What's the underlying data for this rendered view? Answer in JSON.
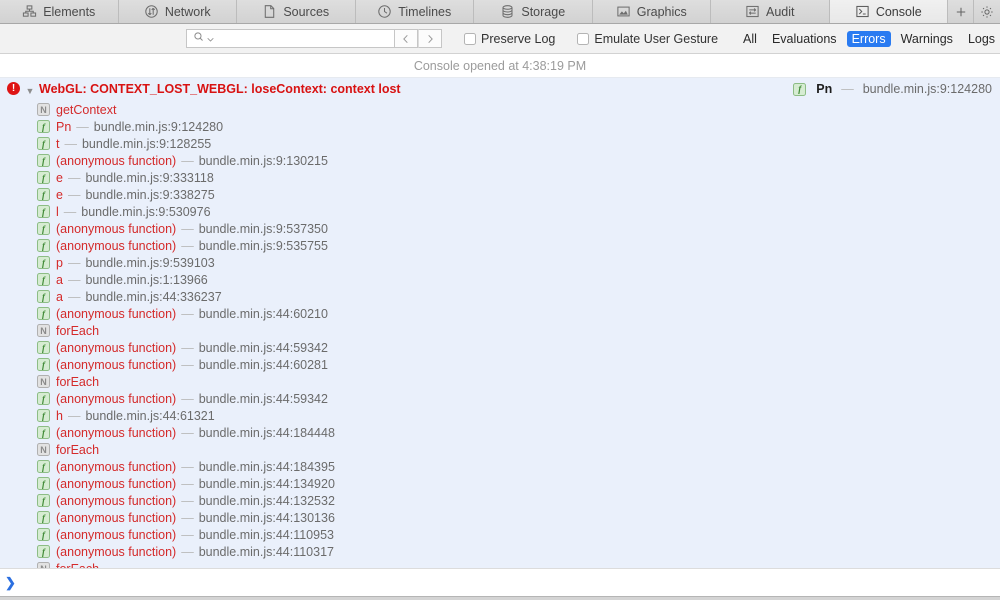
{
  "tabs": [
    {
      "label": "Elements",
      "icon": "elements-icon",
      "active": false
    },
    {
      "label": "Network",
      "icon": "network-icon",
      "active": false
    },
    {
      "label": "Sources",
      "icon": "sources-icon",
      "active": false
    },
    {
      "label": "Timelines",
      "icon": "timelines-icon",
      "active": false
    },
    {
      "label": "Storage",
      "icon": "storage-icon",
      "active": false
    },
    {
      "label": "Graphics",
      "icon": "graphics-icon",
      "active": false
    },
    {
      "label": "Audit",
      "icon": "audit-icon",
      "active": false
    },
    {
      "label": "Console",
      "icon": "console-icon",
      "active": true
    }
  ],
  "tabbar_buttons": [
    {
      "name": "add-tab-button",
      "glyph": "+"
    },
    {
      "name": "settings-gear-button",
      "glyph": "gear-icon"
    }
  ],
  "toolbar": {
    "search_value": "",
    "search_placeholder": "",
    "search_icon": "search-icon",
    "prev_result_label": "‹",
    "next_result_label": "›",
    "checkboxes": [
      {
        "label": "Preserve Log",
        "checked": false
      },
      {
        "label": "Emulate User Gesture",
        "checked": false
      }
    ],
    "filters": [
      {
        "label": "All",
        "active": false
      },
      {
        "label": "Evaluations",
        "active": false
      },
      {
        "label": "Errors",
        "active": true
      },
      {
        "label": "Warnings",
        "active": false
      },
      {
        "label": "Logs",
        "active": false
      }
    ],
    "clear_icon": "refresh-clear-icon",
    "trash_icon": "trash-icon",
    "active_filter_color": "#2a7bf1"
  },
  "console": {
    "opened_at": "Console opened at 4:38:19 PM",
    "prompt_glyph": "❯",
    "error": {
      "badge": "!",
      "disclosure": "▼",
      "message": "WebGL: CONTEXT_LOST_WEBGL: loseContext: context lost",
      "source_badge": "f",
      "source_function": "Pn",
      "source_dash": "—",
      "source_location": "bundle.min.js:9:124280",
      "color": "#d81212"
    },
    "stack_frames": [
      {
        "type": "native",
        "name": "getContext",
        "location": ""
      },
      {
        "type": "function",
        "name": "Pn",
        "location": "bundle.min.js:9:124280"
      },
      {
        "type": "function",
        "name": "t",
        "location": "bundle.min.js:9:128255"
      },
      {
        "type": "function",
        "name": "(anonymous function)",
        "location": "bundle.min.js:9:130215"
      },
      {
        "type": "function",
        "name": "e",
        "location": "bundle.min.js:9:333118"
      },
      {
        "type": "function",
        "name": "e",
        "location": "bundle.min.js:9:338275"
      },
      {
        "type": "function",
        "name": "l",
        "location": "bundle.min.js:9:530976"
      },
      {
        "type": "function",
        "name": "(anonymous function)",
        "location": "bundle.min.js:9:537350"
      },
      {
        "type": "function",
        "name": "(anonymous function)",
        "location": "bundle.min.js:9:535755"
      },
      {
        "type": "function",
        "name": "p",
        "location": "bundle.min.js:9:539103"
      },
      {
        "type": "function",
        "name": "a",
        "location": "bundle.min.js:1:13966"
      },
      {
        "type": "function",
        "name": "a",
        "location": "bundle.min.js:44:336237"
      },
      {
        "type": "function",
        "name": "(anonymous function)",
        "location": "bundle.min.js:44:60210"
      },
      {
        "type": "native",
        "name": "forEach",
        "location": ""
      },
      {
        "type": "function",
        "name": "(anonymous function)",
        "location": "bundle.min.js:44:59342"
      },
      {
        "type": "function",
        "name": "(anonymous function)",
        "location": "bundle.min.js:44:60281"
      },
      {
        "type": "native",
        "name": "forEach",
        "location": ""
      },
      {
        "type": "function",
        "name": "(anonymous function)",
        "location": "bundle.min.js:44:59342"
      },
      {
        "type": "function",
        "name": "h",
        "location": "bundle.min.js:44:61321"
      },
      {
        "type": "function",
        "name": "(anonymous function)",
        "location": "bundle.min.js:44:184448"
      },
      {
        "type": "native",
        "name": "forEach",
        "location": ""
      },
      {
        "type": "function",
        "name": "(anonymous function)",
        "location": "bundle.min.js:44:184395"
      },
      {
        "type": "function",
        "name": "(anonymous function)",
        "location": "bundle.min.js:44:134920"
      },
      {
        "type": "function",
        "name": "(anonymous function)",
        "location": "bundle.min.js:44:132532"
      },
      {
        "type": "function",
        "name": "(anonymous function)",
        "location": "bundle.min.js:44:130136"
      },
      {
        "type": "function",
        "name": "(anonymous function)",
        "location": "bundle.min.js:44:110953"
      },
      {
        "type": "function",
        "name": "(anonymous function)",
        "location": "bundle.min.js:44:110317"
      },
      {
        "type": "native",
        "name": "forEach",
        "location": ""
      }
    ],
    "badge_labels": {
      "function": "f",
      "native": "N"
    },
    "dash": "—"
  }
}
